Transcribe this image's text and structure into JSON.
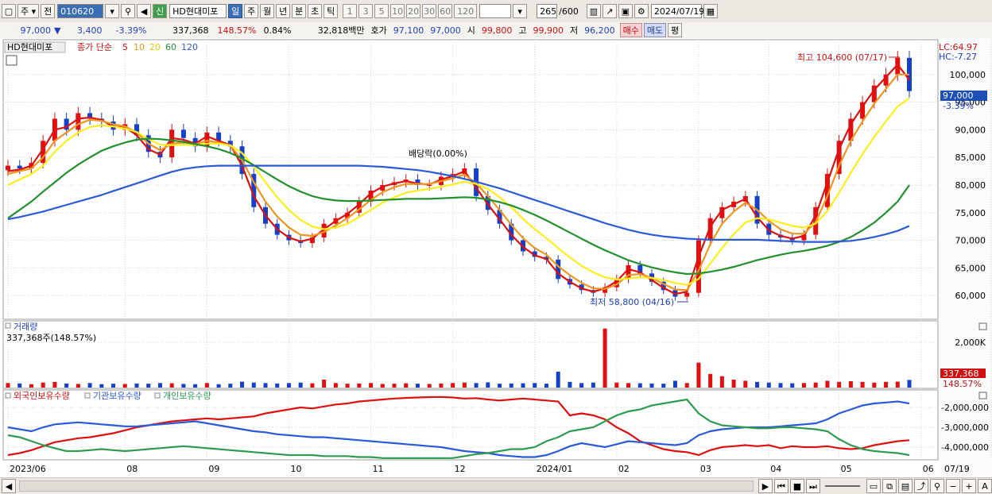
{
  "toolbar": {
    "code": "010620",
    "stock_name": "HD현대미포",
    "pre1": "주",
    "pre2": "전",
    "credit": "신",
    "periods": [
      "일",
      "주",
      "월",
      "년",
      "분",
      "초",
      "틱"
    ],
    "minutes": [
      "1",
      "3",
      "5",
      "10",
      "20",
      "30",
      "60",
      "120"
    ],
    "count": "265",
    "count_total": "/600",
    "date": "2024/07/19"
  },
  "info": {
    "price": "97,000",
    "change": "3,400",
    "change_pct": "-3.39%",
    "volume": "337,368",
    "volume_ratio": "148.57%",
    "turnover": "0.84%",
    "amount": "32,818백만",
    "quote_label": "호가",
    "ask": "97,100",
    "bid": "97,000",
    "open_label": "시",
    "open": "99,800",
    "high_label": "고",
    "high": "99,900",
    "low_label": "저",
    "low": "96,200",
    "buy_label": "매수",
    "sell_label": "매도",
    "avg_label": "평"
  },
  "price_panel": {
    "title": "HD현대미포",
    "legend_prefix": "종가 단순",
    "ma_labels": [
      "5",
      "10",
      "20",
      "60",
      "120"
    ],
    "lc": "LC:64.97",
    "hc": "HC:-7.27",
    "max_label": "최고 104,600 (07/17)",
    "min_label": "최저 58,800 (04/16)",
    "dividend_label": "배당락(0.00%)",
    "current_label": "97,000",
    "current_pct": "-3.39%"
  },
  "volume_panel": {
    "title": "거래량",
    "subtitle": "337,368주(148.57%)",
    "current_label": "337,368",
    "current_pct": "148.57%"
  },
  "holding_panel": {
    "series": [
      "외국인보유수량",
      "기관보유수량",
      "개인보유수량"
    ]
  },
  "colors": {
    "up": "#e01010",
    "down": "#1540c8",
    "ma5": "#dd1111",
    "ma10": "#f0961e",
    "ma20": "#ffee1a",
    "ma60": "#22902e",
    "ma120": "#2a5ad8",
    "foreign": "#dd1111",
    "inst": "#2a5ad8",
    "indiv": "#2e9a52"
  },
  "chart_data": [
    {
      "type": "line",
      "title": "HD현대미포",
      "x": [
        "2023/06",
        "08",
        "09",
        "10",
        "11",
        "12",
        "2024/01",
        "02",
        "03",
        "04",
        "05",
        "06",
        "07",
        "07/19"
      ],
      "ylim": [
        56000,
        106000
      ],
      "yticks": [
        "60,000",
        "65,000",
        "70,000",
        "75,000",
        "80,000",
        "85,000",
        "90,000",
        "95,000",
        "100,000"
      ],
      "series": [
        {
          "name": "종가",
          "values": [
            83500,
            83000,
            84000,
            88000,
            92000,
            90000,
            93000,
            92000,
            91500,
            90000,
            91000,
            89000,
            86000,
            85000,
            90000,
            88500,
            87000,
            89500,
            88000,
            87000,
            82000,
            76000,
            73000,
            71000,
            70000,
            69500,
            70500,
            73000,
            74000,
            75000,
            77000,
            79000,
            80000,
            80500,
            81000,
            80000,
            80000,
            81500,
            82000,
            83000,
            78000,
            75500,
            73000,
            70000,
            68000,
            67000,
            66500,
            63000,
            62000,
            61000,
            60500,
            61500,
            63000,
            65500,
            64000,
            62500,
            61000,
            59800,
            60500,
            70000,
            74000,
            76000,
            77000,
            78000,
            73000,
            71000,
            70500,
            70000,
            71000,
            76000,
            82000,
            88000,
            92000,
            95000,
            98000,
            100000,
            103000,
            97000
          ]
        },
        {
          "name": "5",
          "values": [
            82500,
            82800,
            83500,
            86500,
            90000,
            90500,
            92000,
            92200,
            91800,
            90500,
            90500,
            89000,
            86500,
            85500,
            88500,
            88200,
            87500,
            88800,
            88000,
            87200,
            83500,
            78000,
            74500,
            72000,
            70500,
            69800,
            70300,
            72000,
            73500,
            74800,
            76500,
            78500,
            79700,
            80300,
            80700,
            80300,
            80100,
            81000,
            81600,
            82500,
            79500,
            76500,
            73800,
            71000,
            68800,
            67300,
            66600,
            64000,
            62500,
            61300,
            60700,
            61300,
            62600,
            64800,
            64200,
            62800,
            61400,
            60300,
            60700,
            67000,
            72500,
            75500,
            76500,
            77500,
            74200,
            71800,
            70800,
            70300,
            70800,
            74500,
            80500,
            86500,
            91000,
            94200,
            97200,
            99500,
            101800,
            99000
          ]
        },
        {
          "name": "10",
          "values": [
            82000,
            82500,
            83000,
            85000,
            88000,
            89500,
            91000,
            91800,
            91600,
            91000,
            90600,
            89500,
            87500,
            86300,
            87500,
            87700,
            87400,
            88000,
            87700,
            87100,
            84500,
            80500,
            77000,
            74300,
            72300,
            71000,
            70800,
            71500,
            72700,
            74000,
            75600,
            77300,
            78700,
            79600,
            80200,
            80200,
            80200,
            80700,
            81200,
            81900,
            80300,
            78000,
            75500,
            72800,
            70400,
            68600,
            67400,
            65300,
            63700,
            62300,
            61300,
            61200,
            62000,
            63700,
            63900,
            63200,
            62100,
            61100,
            61000,
            64500,
            69300,
            73000,
            75200,
            76800,
            75500,
            73500,
            72000,
            71200,
            71200,
            73300,
            78000,
            83500,
            88000,
            91500,
            94700,
            97400,
            100000,
            100000
          ]
        },
        {
          "name": "20",
          "values": [
            80000,
            81000,
            82000,
            83500,
            86000,
            88000,
            89500,
            90500,
            90800,
            90600,
            90200,
            89600,
            88300,
            87300,
            87200,
            87300,
            87200,
            87500,
            87500,
            87200,
            85800,
            83300,
            80500,
            77800,
            75500,
            73700,
            72500,
            72000,
            72300,
            73000,
            74200,
            75500,
            76800,
            77800,
            78600,
            79000,
            79300,
            79700,
            80100,
            80600,
            80200,
            79300,
            77800,
            76000,
            73900,
            72000,
            70400,
            68600,
            66900,
            65400,
            64200,
            63300,
            62900,
            63100,
            63300,
            63200,
            62800,
            62300,
            61900,
            63000,
            65800,
            68600,
            71100,
            73200,
            74000,
            73800,
            73200,
            72600,
            72300,
            73000,
            75300,
            78600,
            82200,
            85600,
            88700,
            91500,
            94200,
            95700
          ]
        },
        {
          "name": "60",
          "values": [
            74000,
            75500,
            77000,
            78800,
            80500,
            82200,
            83700,
            85000,
            86200,
            87000,
            87700,
            88200,
            88400,
            88300,
            88100,
            87800,
            87400,
            87000,
            86500,
            85800,
            84800,
            83600,
            82300,
            81000,
            79800,
            78800,
            78000,
            77500,
            77200,
            77100,
            77100,
            77200,
            77300,
            77400,
            77500,
            77500,
            77500,
            77600,
            77700,
            77800,
            77700,
            77400,
            76900,
            76300,
            75500,
            74600,
            73600,
            72500,
            71400,
            70300,
            69200,
            68200,
            67300,
            66400,
            65700,
            65100,
            64600,
            64200,
            63900,
            64000,
            64300,
            64700,
            65200,
            65800,
            66400,
            66900,
            67400,
            67800,
            68100,
            68500,
            69000,
            69700,
            70600,
            71800,
            73200,
            75000,
            77000,
            80000
          ]
        },
        {
          "name": "120",
          "values": [
            73800,
            74200,
            74700,
            75200,
            75800,
            76400,
            77000,
            77600,
            78200,
            78900,
            79600,
            80300,
            81000,
            81700,
            82400,
            82900,
            83200,
            83400,
            83500,
            83500,
            83500,
            83500,
            83500,
            83500,
            83500,
            83500,
            83500,
            83500,
            83500,
            83500,
            83500,
            83400,
            83300,
            83100,
            82900,
            82700,
            82400,
            82000,
            81600,
            81100,
            80600,
            80000,
            79400,
            78700,
            78000,
            77300,
            76600,
            75900,
            75200,
            74500,
            73800,
            73100,
            72500,
            71900,
            71400,
            71000,
            70700,
            70500,
            70300,
            70200,
            70100,
            70100,
            70100,
            70100,
            70100,
            70000,
            69900,
            69800,
            69700,
            69700,
            69700,
            69800,
            69900,
            70200,
            70600,
            71100,
            71700,
            72600
          ]
        }
      ]
    },
    {
      "type": "bar",
      "title": "거래량",
      "ylim": [
        0,
        2800000
      ],
      "yticks": [
        "2,000K"
      ],
      "series": [
        {
          "name": "거래량",
          "values": [
            200000,
            180000,
            150000,
            220000,
            250000,
            180000,
            160000,
            200000,
            150000,
            170000,
            160000,
            180000,
            170000,
            200000,
            190000,
            160000,
            150000,
            200000,
            150000,
            170000,
            260000,
            220000,
            200000,
            180000,
            200000,
            220000,
            190000,
            350000,
            200000,
            170000,
            180000,
            200000,
            160000,
            170000,
            190000,
            170000,
            160000,
            180000,
            200000,
            220000,
            200000,
            230000,
            170000,
            180000,
            190000,
            200000,
            170000,
            700000,
            250000,
            200000,
            220000,
            2600000,
            220000,
            200000,
            190000,
            180000,
            170000,
            300000,
            200000,
            1100000,
            600000,
            500000,
            350000,
            300000,
            250000,
            220000,
            200000,
            190000,
            200000,
            220000,
            300000,
            250000,
            280000,
            250000,
            220000,
            250000,
            260000,
            337368
          ]
        }
      ]
    },
    {
      "type": "line",
      "title": "외국인보유수량 · 기관보유수량 · 개인보유수량",
      "ylim": [
        -4600000,
        -1200000
      ],
      "yticks": [
        "-2,000,000",
        "-3,000,000",
        "-4,000,000"
      ],
      "series": [
        {
          "name": "외국인보유수량",
          "values": [
            -4400000,
            -4300000,
            -4150000,
            -3950000,
            -3750000,
            -3650000,
            -3550000,
            -3500000,
            -3400000,
            -3300000,
            -3150000,
            -3000000,
            -2900000,
            -2800000,
            -2700000,
            -2650000,
            -2600000,
            -2550000,
            -2600000,
            -2550000,
            -2500000,
            -2450000,
            -2300000,
            -2200000,
            -2100000,
            -2000000,
            -2050000,
            -1950000,
            -1850000,
            -1800000,
            -1700000,
            -1650000,
            -1600000,
            -1550000,
            -1520000,
            -1500000,
            -1480000,
            -1470000,
            -1500000,
            -1550000,
            -1530000,
            -1600000,
            -1650000,
            -1600000,
            -1550000,
            -1600000,
            -1650000,
            -1700000,
            -2400000,
            -2300000,
            -2400000,
            -2600000,
            -3000000,
            -3300000,
            -3700000,
            -3900000,
            -4100000,
            -4200000,
            -4250000,
            -4400000,
            -4150000,
            -4000000,
            -3950000,
            -3900000,
            -3950000,
            -3900000,
            -4050000,
            -3950000,
            -4000000,
            -4000000,
            -3950000,
            -4050000,
            -4100000,
            -4050000,
            -3900000,
            -3800000,
            -3700000,
            -3650000
          ]
        },
        {
          "name": "기관보유수량",
          "values": [
            -3000000,
            -3100000,
            -3200000,
            -3000000,
            -2850000,
            -2800000,
            -2750000,
            -2800000,
            -2850000,
            -2900000,
            -2950000,
            -2950000,
            -2900000,
            -2850000,
            -2800000,
            -2750000,
            -2700000,
            -2800000,
            -2900000,
            -3000000,
            -3100000,
            -3200000,
            -3250000,
            -3350000,
            -3400000,
            -3450000,
            -3500000,
            -3500000,
            -3550000,
            -3600000,
            -3650000,
            -3700000,
            -3750000,
            -3800000,
            -3850000,
            -3900000,
            -3950000,
            -4000000,
            -4100000,
            -4200000,
            -4250000,
            -4300000,
            -4400000,
            -4450000,
            -4500000,
            -4500000,
            -4400000,
            -4200000,
            -3950000,
            -3800000,
            -3900000,
            -4000000,
            -3850000,
            -3700000,
            -3750000,
            -3800000,
            -3850000,
            -3900000,
            -3800000,
            -3400000,
            -3200000,
            -3100000,
            -3050000,
            -3000000,
            -3000000,
            -3000000,
            -2950000,
            -2900000,
            -2850000,
            -2800000,
            -2600000,
            -2300000,
            -2100000,
            -1900000,
            -1800000,
            -1750000,
            -1700000,
            -1800000
          ]
        },
        {
          "name": "개인보유수량",
          "values": [
            -3400000,
            -3500000,
            -3700000,
            -3900000,
            -4050000,
            -4200000,
            -4200000,
            -4150000,
            -4100000,
            -4150000,
            -4200000,
            -4150000,
            -4100000,
            -4050000,
            -4000000,
            -3950000,
            -4000000,
            -4050000,
            -4100000,
            -4150000,
            -4200000,
            -4250000,
            -4300000,
            -4350000,
            -4400000,
            -4400000,
            -4400000,
            -4450000,
            -4450000,
            -4450000,
            -4500000,
            -4500000,
            -4550000,
            -4550000,
            -4550000,
            -4550000,
            -4550000,
            -4550000,
            -4550000,
            -4450000,
            -4350000,
            -4300000,
            -4200000,
            -4100000,
            -4100000,
            -4000000,
            -3700000,
            -3500000,
            -3200000,
            -3100000,
            -3000000,
            -2700000,
            -2400000,
            -2200000,
            -2100000,
            -1900000,
            -1800000,
            -1700000,
            -1600000,
            -2300000,
            -2700000,
            -2900000,
            -2950000,
            -3000000,
            -3050000,
            -3050000,
            -3000000,
            -3000000,
            -3050000,
            -3100000,
            -3200000,
            -3600000,
            -3900000,
            -4100000,
            -4200000,
            -4250000,
            -4300000,
            -4400000
          ]
        }
      ]
    }
  ]
}
